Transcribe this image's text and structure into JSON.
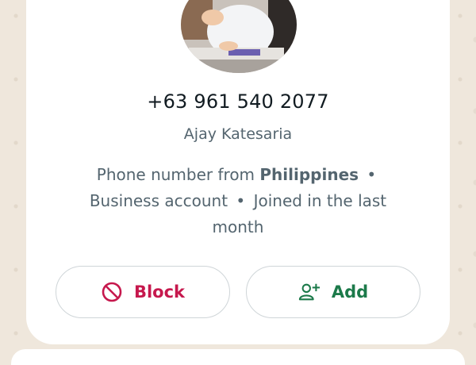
{
  "contact": {
    "phone": "+63 961 540 2077",
    "name": "Ajay Katesaria",
    "info_prefix": "Phone number from ",
    "country": "Philippines",
    "separator": "•",
    "account_type": "Business account",
    "joined": "Joined in the last month"
  },
  "actions": {
    "block_label": "Block",
    "add_label": "Add",
    "block_icon": "block-icon",
    "add_icon": "add-contact-icon"
  },
  "colors": {
    "block": "#c6184d",
    "add": "#1c7a4a",
    "background": "#efe7dc"
  }
}
